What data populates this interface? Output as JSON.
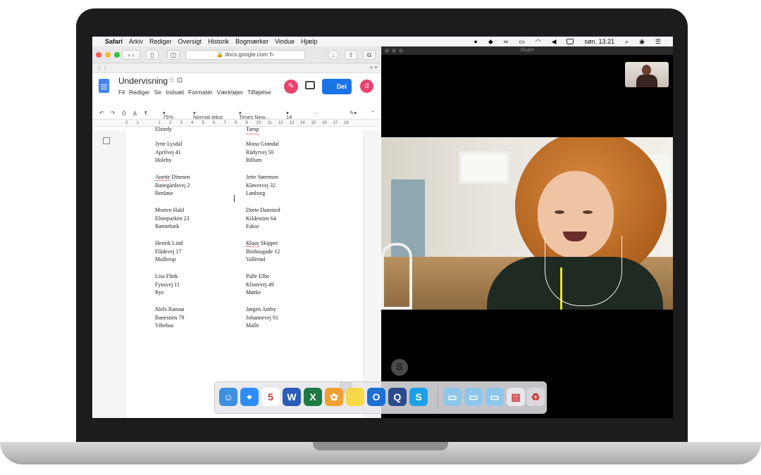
{
  "menubar": {
    "apple": "",
    "app": "Safari",
    "items": [
      "Arkiv",
      "Rediger",
      "Oversigt",
      "Historik",
      "Bogmærker",
      "Vindue",
      "Hjælp"
    ],
    "clock": "søn. 13.21"
  },
  "browser": {
    "url": "docs.google.com",
    "traffic_colors": [
      "#ff5f57",
      "#febc2e",
      "#28c840"
    ]
  },
  "docs": {
    "title": "Undervisning",
    "title_icons": "☆  ⊡",
    "menu": [
      "Fil",
      "Rediger",
      "Se",
      "Indsæt",
      "Formatér",
      "Værktøjer",
      "Tilføjelse"
    ],
    "share_label": "Del",
    "avatar_letter": "d",
    "zoom": "75%",
    "style": "Normal tekst",
    "font": "Times New...",
    "font_size": "14",
    "ruler": [
      "2",
      "1",
      "",
      "1",
      "2",
      "3",
      "4",
      "5",
      "6",
      "7",
      "8",
      "9",
      "10",
      "11",
      "12",
      "13",
      "14",
      "15",
      "16",
      "17",
      "18"
    ],
    "top_clipped_left": "Elstedy",
    "top_clipped_right": "Tarup",
    "left_column": [
      {
        "name": "Jytte Lysdal",
        "street": "Aprilvej  41",
        "city": "Holeby"
      },
      {
        "name": "Anette Dinesen",
        "street": "Banegårdsvej  2",
        "city": "Benløse"
      },
      {
        "name": "Morten Hald",
        "street": "Elmeparken  23",
        "city": "Rønnebæk"
      },
      {
        "name": "Henrik Lind",
        "street": "Flådevej  17",
        "city": "Mullerup"
      },
      {
        "name": "Lisa Flink",
        "street": "Fynsvej  11",
        "city": "Rye"
      },
      {
        "name": "Niels Ramsø",
        "street": "Banestien  79",
        "city": "Vibehus"
      }
    ],
    "right_column": [
      {
        "name": "Mona Grøndal",
        "street": "Rådyrvej  50",
        "city": "Billum"
      },
      {
        "name": "Jette Sørensen",
        "street": "Kløvervej  32",
        "city": "Lønborg"
      },
      {
        "name": "Dorte Damsted",
        "street": "Kildestien  64",
        "city": "Fakse"
      },
      {
        "name": "Klaus Skipper",
        "street": "Brohusgade  12",
        "city": "Vallerød"
      },
      {
        "name": "Palle Elbo",
        "street": "Klintevej  49",
        "city": "Mørke"
      },
      {
        "name": "Jørgen Amby",
        "street": "Johannevej  91",
        "city": "Malle"
      }
    ]
  },
  "skype": {
    "window_title": "Skype",
    "logo": "S"
  },
  "dock": {
    "icons": [
      {
        "name": "finder",
        "glyph": "☺",
        "color": "#3d8fe0"
      },
      {
        "name": "safari",
        "glyph": "⌖",
        "color": "#2f8cf5"
      },
      {
        "name": "calendar",
        "glyph": "5",
        "color": "#ffffff"
      },
      {
        "name": "word",
        "glyph": "W",
        "color": "#2b5cb8"
      },
      {
        "name": "excel",
        "glyph": "X",
        "color": "#1e7a44"
      },
      {
        "name": "photos",
        "glyph": "✿",
        "color": "#f0a030"
      },
      {
        "name": "notes",
        "glyph": "",
        "color": "#f5d94a"
      },
      {
        "name": "outlook",
        "glyph": "O",
        "color": "#1d6fd1"
      },
      {
        "name": "quicktime",
        "glyph": "Q",
        "color": "#2a4a8a"
      },
      {
        "name": "skype",
        "glyph": "S",
        "color": "#1aa0e8"
      },
      {
        "name": "applications-folder",
        "glyph": "▭",
        "color": "#8ec6ea"
      },
      {
        "name": "documents-folder",
        "glyph": "▭",
        "color": "#8ec6ea"
      },
      {
        "name": "downloads-folder",
        "glyph": "▭",
        "color": "#8ec6ea"
      },
      {
        "name": "document-stack",
        "glyph": "▤",
        "color": "#e8e8ee"
      },
      {
        "name": "trash",
        "glyph": "♻",
        "color": "#d8d8dc"
      }
    ]
  }
}
